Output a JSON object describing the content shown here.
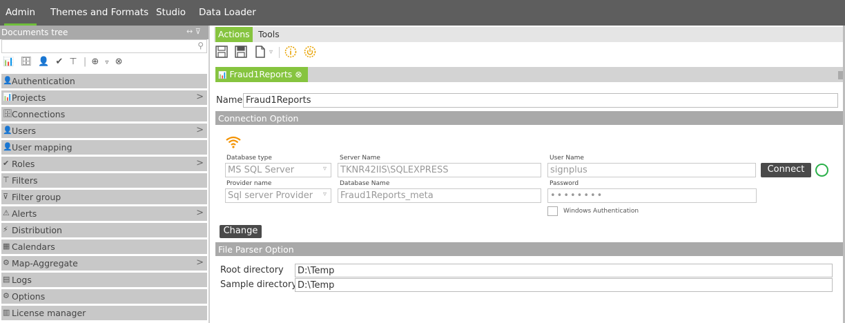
{
  "topbar": {
    "items": [
      "Admin",
      "Themes and Formats",
      "Studio",
      "Data Loader"
    ]
  },
  "sidebar": {
    "title": "Documents tree",
    "pin_icons": "↔ ⊽",
    "search_placeholder": "",
    "toolbar_icons": [
      "📊",
      "🗄",
      "👤",
      "✔",
      "⊤",
      "⊕",
      "▿",
      "⊗"
    ],
    "items": [
      {
        "icon": "👤",
        "label": "Authentication",
        "arrow": ""
      },
      {
        "icon": "📊",
        "label": "Projects",
        "arrow": ">"
      },
      {
        "icon": "🗄",
        "label": "Connections",
        "arrow": ""
      },
      {
        "icon": "👤",
        "label": "Users",
        "arrow": ">"
      },
      {
        "icon": "👤",
        "label": "User mapping",
        "arrow": ""
      },
      {
        "icon": "✔",
        "label": "Roles",
        "arrow": ">"
      },
      {
        "icon": "⊤",
        "label": "Filters",
        "arrow": ""
      },
      {
        "icon": "⊽",
        "label": "Filter group",
        "arrow": ""
      },
      {
        "icon": "⚠",
        "label": "Alerts",
        "arrow": ">"
      },
      {
        "icon": "⚡",
        "label": "Distribution",
        "arrow": ""
      },
      {
        "icon": "▦",
        "label": "Calendars",
        "arrow": ""
      },
      {
        "icon": "⚙",
        "label": "Map-Aggregate",
        "arrow": ">"
      },
      {
        "icon": "▤",
        "label": "Logs",
        "arrow": ""
      },
      {
        "icon": "⚙",
        "label": "Options",
        "arrow": ""
      },
      {
        "icon": "▥",
        "label": "License manager",
        "arrow": ""
      }
    ]
  },
  "main": {
    "tabs": [
      "Actions",
      "Tools"
    ],
    "doc_tab": {
      "label": "Fraud1Reports",
      "close": "⊗"
    },
    "name_label": "Name:",
    "name_value": "Fraud1Reports",
    "connection_section": "Connection Option",
    "db_type_label": "Database type",
    "db_type_value": "MS SQL Server",
    "server_name_label": "Server Name",
    "server_name_value": "TKNR42IIS\\SQLEXPRESS",
    "user_name_label": "User Name",
    "user_name_value": "signplus",
    "provider_label": "Provider name",
    "provider_value": "Sql server Provider",
    "db_name_label": "Database Name",
    "db_name_value": "Fraud1Reports_meta",
    "password_label": "Password",
    "password_value": "••••••••",
    "connect_label": "Connect",
    "win_auth_label": "Windows Authentication",
    "change_label": "Change",
    "file_section": "File Parser Option",
    "root_dir_label": "Root directory",
    "root_dir_value": "D:\\Temp",
    "sample_dir_label": "Sample directory",
    "sample_dir_value": "D:\\Temp"
  },
  "colors": {
    "accent": "#86c43f",
    "header": "#5e5e5e",
    "section": "#a9a9a9",
    "status_ok": "#2bb04a"
  }
}
